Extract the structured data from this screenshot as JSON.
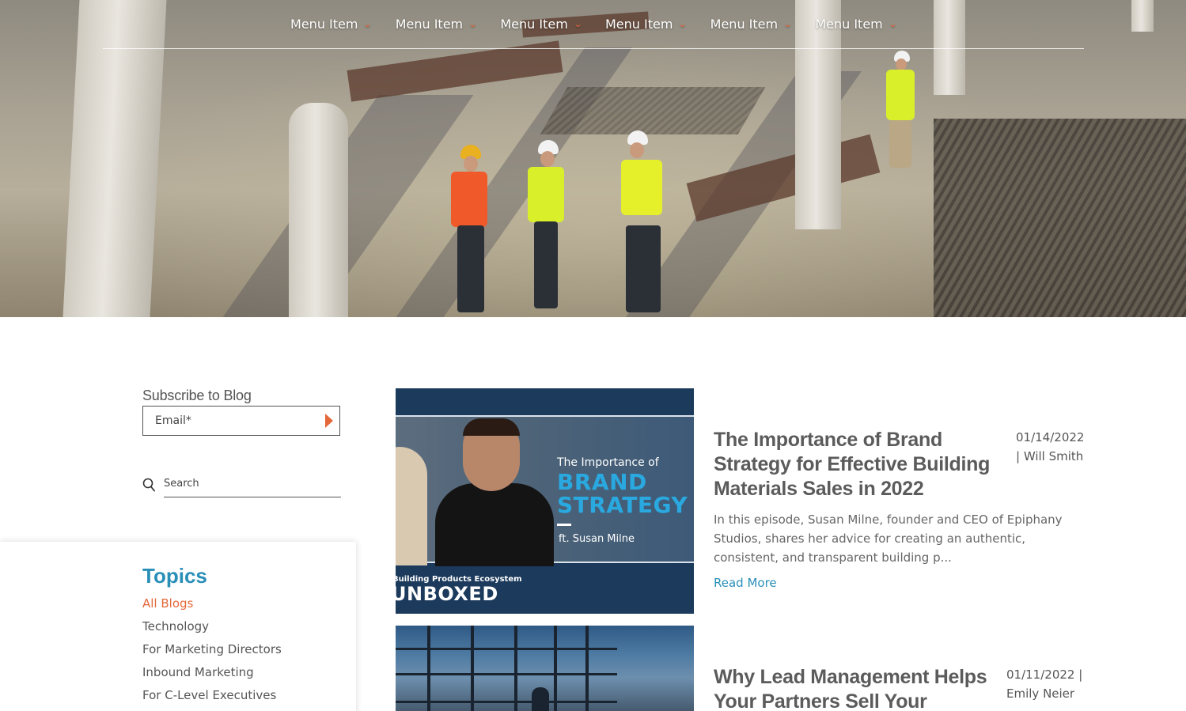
{
  "nav": {
    "items": [
      {
        "label": "Menu Item"
      },
      {
        "label": "Menu Item"
      },
      {
        "label": "Menu Item"
      },
      {
        "label": "Menu Item"
      },
      {
        "label": "Menu Item"
      },
      {
        "label": "Menu Item"
      }
    ],
    "chevron": "⌄"
  },
  "sidebar": {
    "subscribe_title": "Subscribe to Blog",
    "email_placeholder": "Email*",
    "search_placeholder": "Search",
    "topics_title": "Topics",
    "topics": [
      {
        "label": "All Blogs",
        "active": true
      },
      {
        "label": "Technology"
      },
      {
        "label": "For Marketing Directors"
      },
      {
        "label": "Inbound Marketing"
      },
      {
        "label": "For C-Level Executives"
      }
    ]
  },
  "posts": [
    {
      "title": "The Importance of Brand Strategy for Effective Building Materials Sales in 2022",
      "date": "01/14/2022",
      "author_line": "| Will Smith",
      "excerpt": "In this episode, Susan Milne, founder and CEO of Epiphany Studios, shares her advice for creating an authentic, consistent, and transparent building p...",
      "read_more": "Read More",
      "image": {
        "small_text": "The Importance of",
        "big_line1": "BRAND",
        "big_line2": "STRATEGY",
        "feat": "ft. Susan Milne",
        "footer_small": "Building Products Ecosystem",
        "footer_big": "UNBOXED"
      }
    },
    {
      "title": "Why Lead Management Helps Your Partners Sell Your Products",
      "date": "01/11/2022 |",
      "author_line": "Emily Neier"
    }
  ],
  "colors": {
    "accent": "#e4683a",
    "link": "#2a8fb8",
    "text": "#555555"
  }
}
